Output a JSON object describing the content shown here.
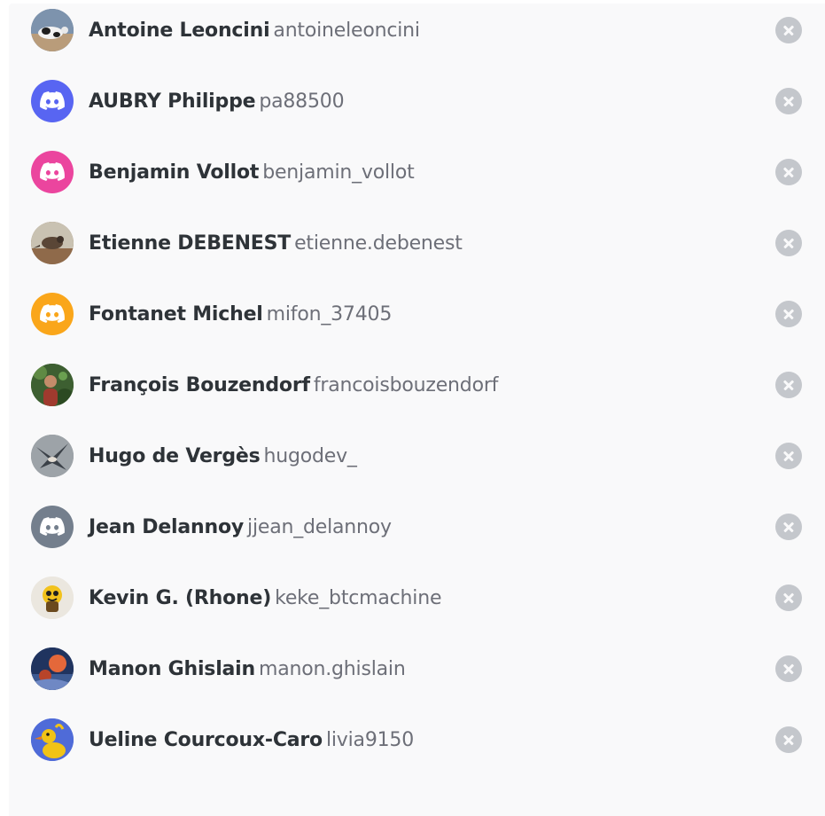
{
  "members": [
    {
      "display_name": "Antoine Leoncini",
      "username": "antoineleoncini",
      "avatar": "photo-cow-icon",
      "color": "#5a6f8a"
    },
    {
      "display_name": "AUBRY Philippe",
      "username": "pa88500",
      "avatar": "discord-default-icon",
      "color": "#5865f2"
    },
    {
      "display_name": "Benjamin Vollot",
      "username": "benjamin_vollot",
      "avatar": "discord-default-icon",
      "color": "#eb459e"
    },
    {
      "display_name": "Etienne DEBENEST",
      "username": "etienne.debenest",
      "avatar": "photo-bird-icon",
      "color": "#8a6b4c"
    },
    {
      "display_name": "Fontanet Michel",
      "username": "mifon_37405",
      "avatar": "discord-default-icon",
      "color": "#faa61a"
    },
    {
      "display_name": "François Bouzendorf",
      "username": "francoisbouzendorf",
      "avatar": "photo-person-icon",
      "color": "#4a6b3a"
    },
    {
      "display_name": "Hugo de Vergès",
      "username": "hugodev_",
      "avatar": "photo-swallow-icon",
      "color": "#8a8f94"
    },
    {
      "display_name": "Jean Delannoy",
      "username": "jjean_delannoy",
      "avatar": "discord-default-icon",
      "color": "#747f8d"
    },
    {
      "display_name": "Kevin G. (Rhone)",
      "username": "keke_btcmachine",
      "avatar": "photo-mascot-icon",
      "color": "#e8e4dc"
    },
    {
      "display_name": "Manon Ghislain",
      "username": "manon.ghislain",
      "avatar": "photo-sunset-icon",
      "color": "#2a3c6e"
    },
    {
      "display_name": "Ueline Courcoux-Caro",
      "username": "livia9150",
      "avatar": "photo-duck-icon",
      "color": "#4f6bd8"
    }
  ],
  "remove_icon": "close-circle-icon",
  "remove_color": "#c4c7cc"
}
